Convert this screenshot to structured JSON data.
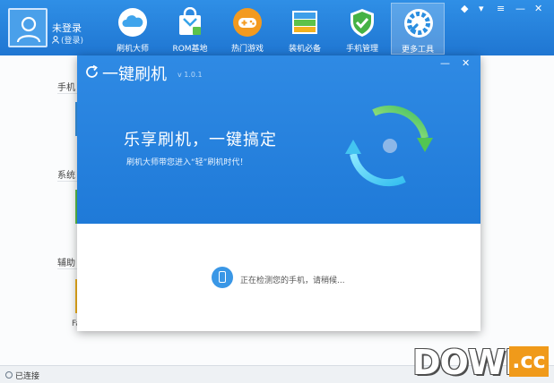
{
  "user": {
    "name": "未登录",
    "login_link": "(登录)"
  },
  "nav": [
    {
      "label": "刷机大师",
      "icon": "cloud-icon"
    },
    {
      "label": "ROM基地",
      "icon": "shopping-bag-icon"
    },
    {
      "label": "热门游戏",
      "icon": "gamepad-icon"
    },
    {
      "label": "装机必备",
      "icon": "app-stack-icon"
    },
    {
      "label": "手机管理",
      "icon": "shield-check-icon"
    },
    {
      "label": "更多工具",
      "icon": "wrench-gear-icon",
      "active": true
    }
  ],
  "side": {
    "section_1": "手机",
    "section_2": "系统",
    "section_3": "辅助",
    "tile_label": "Fa"
  },
  "status": {
    "connection": "已连接"
  },
  "dialog": {
    "title": "一键刷机",
    "version": "v 1.0.1",
    "slogan": "乐享刷机，一键搞定",
    "subtitle": "刷机大师带您进入“轻”刷机时代！",
    "status": "正在检测您的手机，请稍候..."
  },
  "watermark": {
    "text": "DOWN",
    "suffix": ".cc"
  },
  "colors": {
    "header_blue": "#2f8fe6",
    "accent_green": "#5cc24a",
    "watermark_orange": "#f09a1a"
  }
}
